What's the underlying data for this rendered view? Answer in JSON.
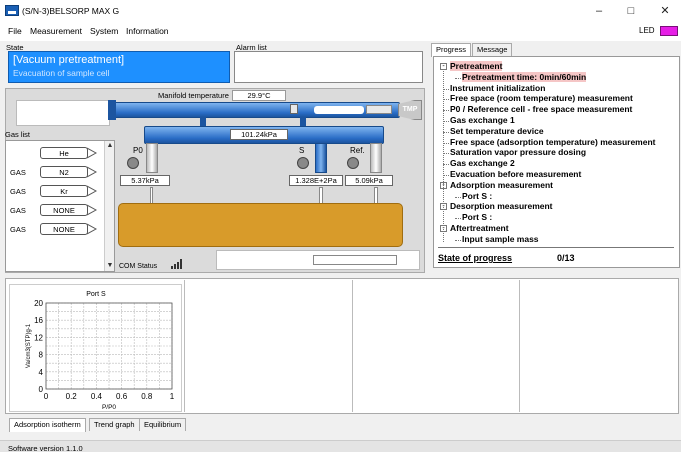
{
  "window": {
    "title": "(S/N-3)BELSORP MAX G",
    "controls": [
      "–",
      "□",
      "✕"
    ]
  },
  "menu": {
    "items": [
      "File",
      "Measurement",
      "System",
      "Information"
    ],
    "led_label": "LED",
    "led_color": "#e61ee6"
  },
  "state": {
    "label": "State",
    "main": "[Vacuum pretreatment]",
    "sub": "Evacuation of sample cell"
  },
  "alarm": {
    "label": "Alarm list"
  },
  "schematic": {
    "manifold_label": "Manifold temperature",
    "manifold_temp": "29.9°C",
    "vessel_pressure": "101.24kPa",
    "tmp_label": "TMP",
    "ports": [
      {
        "label": "P0",
        "pressure": "5.37kPa"
      },
      {
        "label": "S",
        "pressure": "1.328E+2Pa"
      },
      {
        "label": "Ref.",
        "pressure": "5.09kPa"
      }
    ],
    "com_status": "COM Status"
  },
  "gas_list": {
    "label": "Gas list",
    "rows": [
      {
        "row_label": "",
        "gas": "He"
      },
      {
        "row_label": "GAS",
        "gas": "N2"
      },
      {
        "row_label": "GAS",
        "gas": "Kr"
      },
      {
        "row_label": "GAS",
        "gas": "NONE"
      },
      {
        "row_label": "GAS",
        "gas": "NONE"
      }
    ]
  },
  "progress_panel": {
    "tabs": [
      "Progress",
      "Message"
    ],
    "steps": [
      {
        "text": "Pretreatment",
        "level": 0,
        "expander": true,
        "highlight": true
      },
      {
        "text": "Pretreatment time: 0min/60min",
        "level": 1,
        "expander": false,
        "highlight": true
      },
      {
        "text": "Instrument initialization",
        "level": 0,
        "expander": false,
        "highlight": false
      },
      {
        "text": "Free space (room temperature) measurement",
        "level": 0,
        "expander": false,
        "highlight": false
      },
      {
        "text": "P0 / Reference cell - free space measurement",
        "level": 0,
        "expander": false,
        "highlight": false
      },
      {
        "text": "Gas exchange 1",
        "level": 0,
        "expander": false,
        "highlight": false
      },
      {
        "text": "Set temperature device",
        "level": 0,
        "expander": false,
        "highlight": false
      },
      {
        "text": "Free space (adsorption temperature) measurement",
        "level": 0,
        "expander": false,
        "highlight": false
      },
      {
        "text": "Saturation vapor pressure dosing",
        "level": 0,
        "expander": false,
        "highlight": false
      },
      {
        "text": "Gas exchange 2",
        "level": 0,
        "expander": false,
        "highlight": false
      },
      {
        "text": "Evacuation before measurement",
        "level": 0,
        "expander": false,
        "highlight": false
      },
      {
        "text": "Adsorption measurement",
        "level": 0,
        "expander": true,
        "highlight": false
      },
      {
        "text": "Port S :",
        "level": 1,
        "expander": false,
        "highlight": false
      },
      {
        "text": "Desorption measurement",
        "level": 0,
        "expander": true,
        "highlight": false
      },
      {
        "text": "Port S :",
        "level": 1,
        "expander": false,
        "highlight": false
      },
      {
        "text": "Aftertreatment",
        "level": 0,
        "expander": true,
        "highlight": false
      },
      {
        "text": "Input sample mass",
        "level": 1,
        "expander": false,
        "highlight": false
      }
    ],
    "state_of_progress_label": "State of progress",
    "state_of_progress_value": "0/13"
  },
  "chart_data": {
    "type": "scatter",
    "title": "Port S",
    "xlabel": "P/P0",
    "ylabel": "Va/cm3(STP)g-1",
    "xlim": [
      0,
      1
    ],
    "ylim": [
      0,
      20
    ],
    "xticks": [
      0,
      0.2,
      0.4,
      0.6,
      0.8,
      1
    ],
    "yticks": [
      0,
      4,
      8,
      12,
      16,
      20
    ],
    "grid": true,
    "series": []
  },
  "bottom_tabs": [
    "Adsorption isotherm",
    "Trend graph",
    "Equilibrium"
  ],
  "footer": {
    "software_version": "Software version 1.1.0"
  }
}
